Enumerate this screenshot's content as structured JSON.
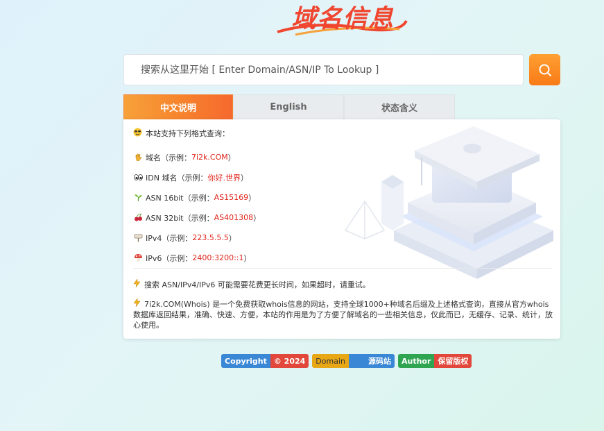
{
  "logo": {
    "text": "域名信息"
  },
  "search": {
    "placeholder": "搜索从这里开始 [ Enter Domain/ASN/IP To Lookup ]"
  },
  "tabs": [
    {
      "label": "中文说明",
      "active": true
    },
    {
      "label": "English",
      "active": false
    },
    {
      "label": "状态含义",
      "active": false
    }
  ],
  "content": {
    "heading": "本站支持下列格式查询：",
    "formats": [
      {
        "icon": "hand-icon",
        "label": "域名（示例：",
        "example": "7i2k.COM",
        "suffix": "）"
      },
      {
        "icon": "eyes-icon",
        "label": "IDN 域名（示例：",
        "example": "你好.世界",
        "suffix": "）"
      },
      {
        "icon": "seedling-icon",
        "label": "ASN 16bit（示例：",
        "example": "AS15169",
        "suffix": "）"
      },
      {
        "icon": "cherries-icon",
        "label": "ASN 32bit（示例：",
        "example": "AS401308",
        "suffix": "）"
      },
      {
        "icon": "signpost-icon",
        "label": "IPv4（示例：",
        "example": "223.5.5.5",
        "suffix": "）"
      },
      {
        "icon": "mushroom-icon",
        "label": "IPv6（示例：",
        "example": "2400:3200::1",
        "suffix": "）"
      }
    ],
    "note1": "搜索 ASN/IPv4/IPv6 可能需要花费更长时间，如果超时，请重试。",
    "note2": "7i2k.COM(Whois) 是一个免费获取whois信息的网站，支持全球1000+种域名后缀及上述格式查询，直接从官方whois数据库返回结果，准确、快速、方便，本站的作用是为了方便了解域名的一些相关信息，仅此而已，无缓存、记录、统计，放心使用。"
  },
  "badges": [
    {
      "left": "Copyright",
      "right": "© 2024"
    },
    {
      "left": "Domain",
      "right": "源码站"
    },
    {
      "left": "Author",
      "right": "保留版权"
    }
  ],
  "colors": {
    "accent": "#f7852d",
    "example_red": "#e2231a"
  }
}
